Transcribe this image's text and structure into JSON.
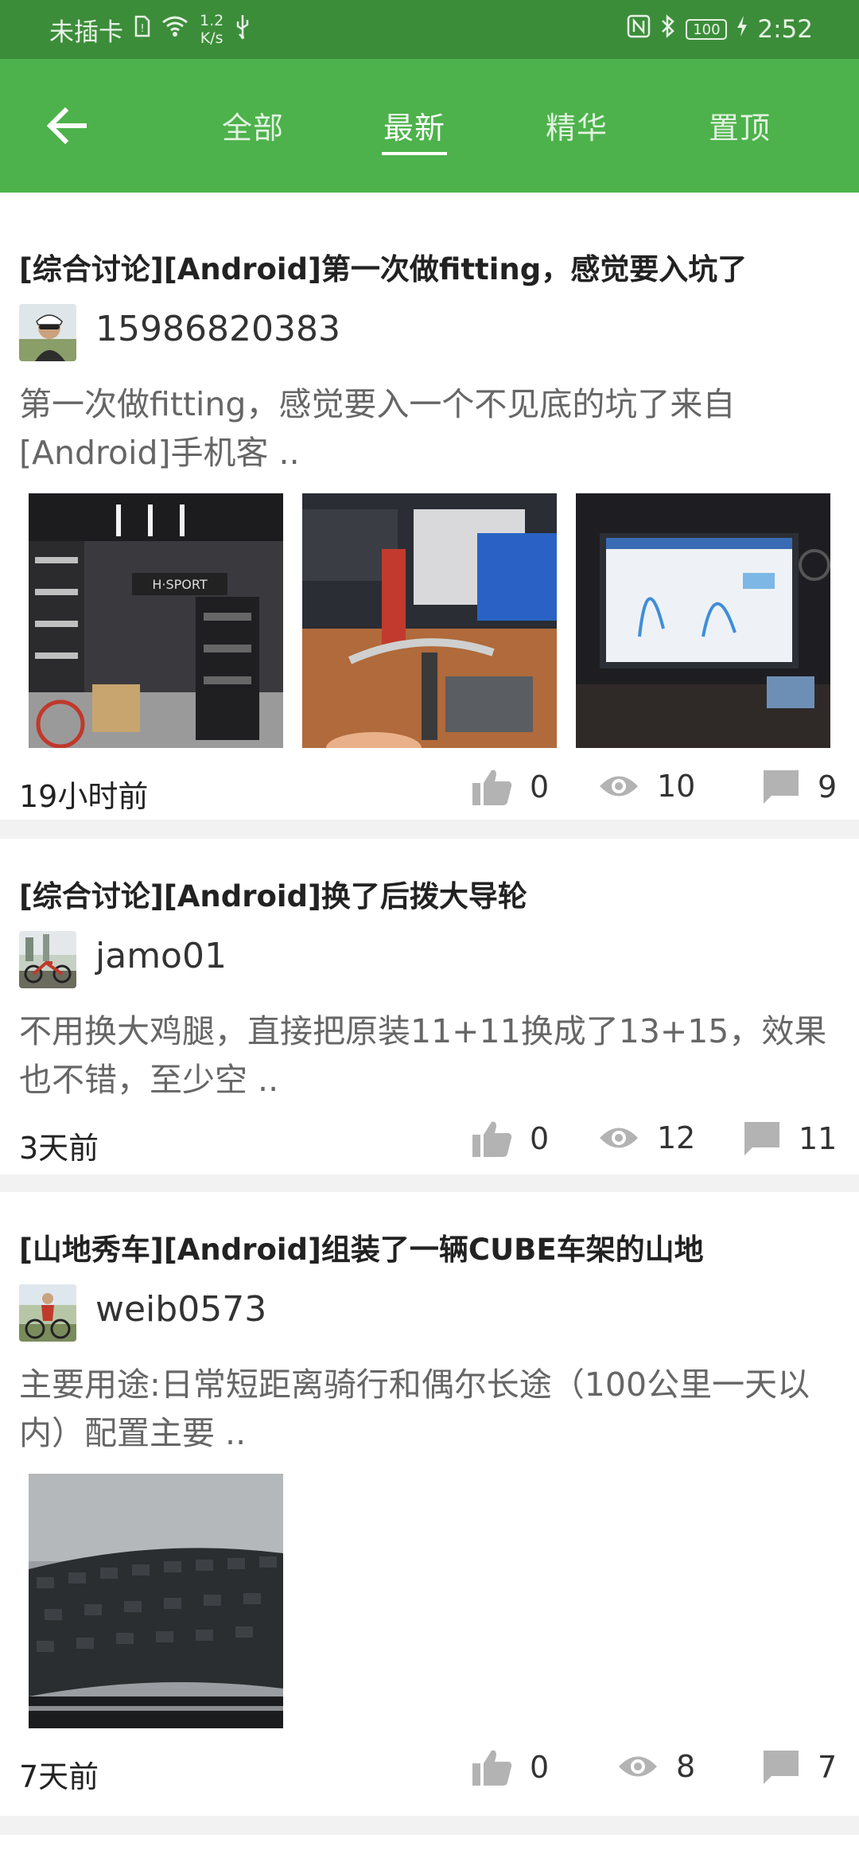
{
  "status_bar": {
    "carrier": "未插卡",
    "speed_value": "1.2",
    "speed_unit": "K/s",
    "battery": "100",
    "time": "2:52"
  },
  "tabs": [
    "全部",
    "最新",
    "精华",
    "置顶"
  ],
  "active_tab": "最新",
  "posts": [
    {
      "title": "[综合讨论][Android]第一次做fitting，感觉要入坑了",
      "author": "15986820383",
      "excerpt": "第一次做fitting，感觉要入一个不见底的坑了来自[Android]手机客 ..",
      "time": "19小时前",
      "likes": "0",
      "views": "10",
      "comments": "9"
    },
    {
      "title": "[综合讨论][Android]换了后拨大导轮",
      "author": "jamo01",
      "excerpt": "不用换大鸡腿，直接把原装11+11换成了13+15，效果也不错，至少空 ..",
      "time": "3天前",
      "likes": "0",
      "views": "12",
      "comments": "11"
    },
    {
      "title": "[山地秀车][Android]组装了一辆CUBE车架的山地",
      "author": "weib0573",
      "excerpt": "主要用途:日常短距离骑行和偶尔长途（100公里一天以内）配置主要 ..",
      "time": "7天前",
      "likes": "0",
      "views": "8",
      "comments": "7"
    }
  ],
  "colors": {
    "status_bar": "#3c8d3a",
    "app_bar": "#4db24b",
    "icon_gray": "#b3b3b3"
  }
}
